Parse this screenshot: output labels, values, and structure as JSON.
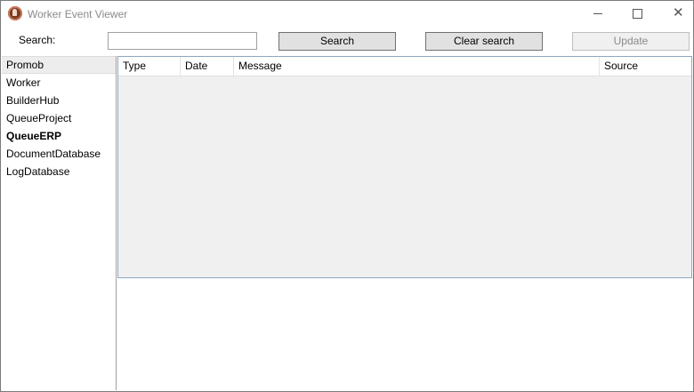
{
  "window": {
    "title": "Worker Event Viewer",
    "icon": "app-icon"
  },
  "search": {
    "label": "Search:",
    "value": "",
    "placeholder": "",
    "search_button": "Search",
    "clear_button": "Clear search",
    "update_button": "Update",
    "update_enabled": false
  },
  "sources": {
    "items": [
      {
        "label": "Promob",
        "selected": true,
        "bold": false
      },
      {
        "label": "Worker",
        "selected": false,
        "bold": false
      },
      {
        "label": "BuilderHub",
        "selected": false,
        "bold": false
      },
      {
        "label": "QueueProject",
        "selected": false,
        "bold": false
      },
      {
        "label": "QueueERP",
        "selected": false,
        "bold": true
      },
      {
        "label": "DocumentDatabase",
        "selected": false,
        "bold": false
      },
      {
        "label": "LogDatabase",
        "selected": false,
        "bold": false
      }
    ]
  },
  "grid": {
    "columns": [
      "Type",
      "Date",
      "Message",
      "Source"
    ],
    "rows": []
  },
  "colors": {
    "grid_border": "#8fa7c0",
    "grid_background": "#f0f0f0",
    "button_background": "#e1e1e1"
  }
}
